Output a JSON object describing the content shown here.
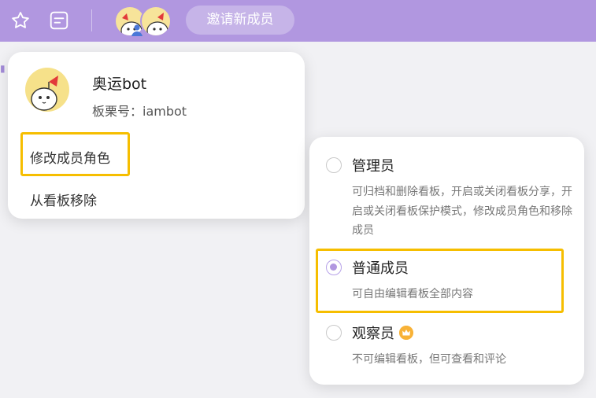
{
  "toolbar": {
    "invite_label": "邀请新成员"
  },
  "member": {
    "name": "奥运bot",
    "board_id_label": "板栗号：iambot"
  },
  "member_menu": {
    "change_role": "修改成员角色",
    "remove": "从看板移除"
  },
  "roles": [
    {
      "name": "管理员",
      "desc": "可归档和删除看板，开启或关闭看板分享，开启或关闭看板保护模式，修改成员角色和移除成员",
      "selected": false
    },
    {
      "name": "普通成员",
      "desc": "可自由编辑看板全部内容",
      "selected": true
    },
    {
      "name": "观察员",
      "desc": "不可编辑看板，但可查看和评论",
      "selected": false
    }
  ],
  "colors": {
    "topbar": "#b197e0",
    "highlight": "#f6be00",
    "radio_selected": "#b197e0",
    "crown": "#f8b237"
  },
  "icons": [
    "star-icon",
    "list-icon",
    "crown-icon"
  ]
}
